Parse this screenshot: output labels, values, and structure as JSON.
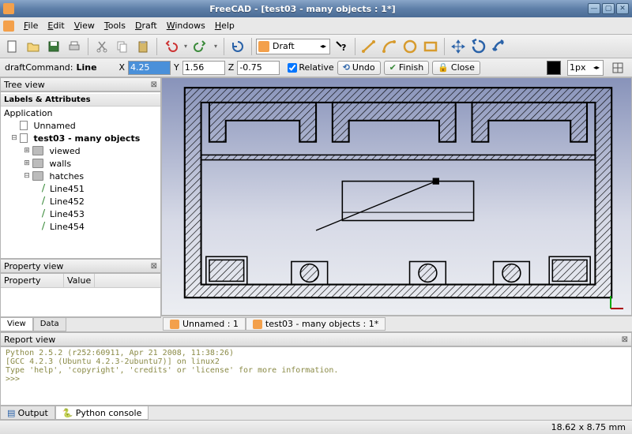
{
  "window": {
    "title": "FreeCAD - [test03 - many objects : 1*]"
  },
  "menu": [
    "File",
    "Edit",
    "View",
    "Tools",
    "Draft",
    "Windows",
    "Help"
  ],
  "workbench": {
    "current": "Draft"
  },
  "cmdbar": {
    "label": "draftCommand:",
    "command": "Line",
    "x_label": "X",
    "x": "4.25",
    "y_label": "Y",
    "y": "1.56",
    "z_label": "Z",
    "z": "-0.75",
    "relative_label": "Relative",
    "undo": "Undo",
    "finish": "Finish",
    "close": "Close",
    "linewidth": "1px"
  },
  "panels": {
    "tree_title": "Tree view",
    "tree_header": "Labels & Attributes",
    "app_label": "Application",
    "propview_title": "Property view",
    "prop_col": "Property",
    "val_col": "Value",
    "view_tab": "View",
    "data_tab": "Data",
    "report_title": "Report view",
    "output_tab": "Output",
    "console_tab": "Python console"
  },
  "tree": {
    "unnamed": "Unnamed",
    "doc": "test03 - many objects",
    "folders": [
      "viewed",
      "walls",
      "hatches"
    ],
    "lines": [
      "Line451",
      "Line452",
      "Line453",
      "Line454"
    ]
  },
  "doc_tabs": [
    "Unnamed : 1",
    "test03 - many objects : 1*"
  ],
  "report": "Python 2.5.2 (r252:60911, Apr 21 2008, 11:38:26)\n[GCC 4.2.3 (Ubuntu 4.2.3-2ubuntu7)] on linux2\nType 'help', 'copyright', 'credits' or 'license' for more information.\n>>> ",
  "status": "18.62 x 8.75 mm"
}
